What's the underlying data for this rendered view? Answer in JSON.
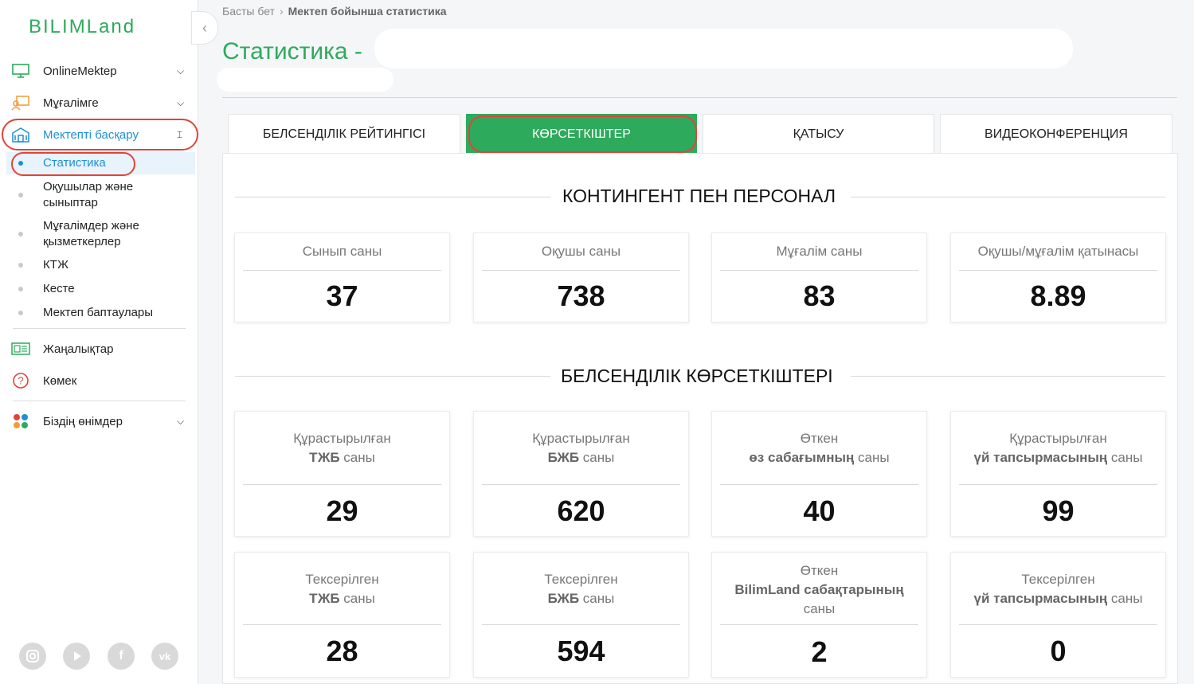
{
  "app": {
    "logo_text": "BILIMLand"
  },
  "sidebar": {
    "items": [
      {
        "label": "OnlineMektep",
        "icon": "monitor-icon"
      },
      {
        "label": "Мұғалімге",
        "icon": "teacher-icon"
      },
      {
        "label": "Мектепті басқару",
        "icon": "school-icon"
      },
      {
        "label": "Жаңалықтар",
        "icon": "newspaper-icon"
      },
      {
        "label": "Көмек",
        "icon": "help-icon"
      },
      {
        "label": "Біздің өнімдер",
        "icon": "products-icon"
      }
    ],
    "subitems": [
      {
        "label": "Статистика"
      },
      {
        "label_l1": "Оқушылар және",
        "label_l2": "сыныптар"
      },
      {
        "label_l1": "Мұғалімдер және",
        "label_l2": "қызметкерлер"
      },
      {
        "label": "КТЖ"
      },
      {
        "label": "Кесте"
      },
      {
        "label": "Мектеп баптаулары"
      }
    ],
    "social": [
      "instagram-icon",
      "youtube-icon",
      "facebook-icon",
      "vk-icon"
    ]
  },
  "breadcrumb": {
    "home": "Басты бет",
    "current": "Мектеп бойынша статистика"
  },
  "page": {
    "title": "Статистика - "
  },
  "tabs": [
    {
      "label": "БЕЛСЕНДІЛІК РЕЙТИНГІСІ"
    },
    {
      "label": "КӨРСЕТКІШТЕР"
    },
    {
      "label": "ҚАТЫСУ"
    },
    {
      "label": "ВИДЕОКОНФЕРЕНЦИЯ"
    }
  ],
  "section1": {
    "title": "КОНТИНГЕНТ ПЕН ПЕРСОНАЛ",
    "cards": [
      {
        "title": "Сынып саны",
        "value": "37"
      },
      {
        "title": "Оқушы саны",
        "value": "738"
      },
      {
        "title": "Мұғалім саны",
        "value": "83"
      },
      {
        "title": "Оқушы/мұғалім қатынасы",
        "value": "8.89"
      }
    ]
  },
  "section2": {
    "title": "БЕЛСЕНДІЛІК КӨРСЕТКІШТЕРІ",
    "cards": [
      {
        "l1": "Құрастырылған",
        "l2b": "ТЖБ",
        "l2": " саны",
        "value": "29"
      },
      {
        "l1": "Құрастырылған",
        "l2b": "БЖБ",
        "l2": " саны",
        "value": "620"
      },
      {
        "l1": "Өткен",
        "l2b": "өз сабағымның",
        "l2": " саны",
        "value": "40"
      },
      {
        "l1": "Құрастырылған",
        "l2b": "үй тапсырмасының",
        "l2": " саны",
        "value": "99"
      },
      {
        "l1": "Тексерілген",
        "l2b": "ТЖБ",
        "l2": " саны",
        "value": "28"
      },
      {
        "l1": "Тексерілген",
        "l2b": "БЖБ",
        "l2": " саны",
        "value": "594"
      },
      {
        "l1": "Өткен",
        "l2b": "BilimLand сабақтарының",
        "l3": "саны",
        "value": "2"
      },
      {
        "l1": "Тексерілген",
        "l2b": "үй тапсырмасының",
        "l2": " саны",
        "value": "0"
      }
    ]
  }
}
